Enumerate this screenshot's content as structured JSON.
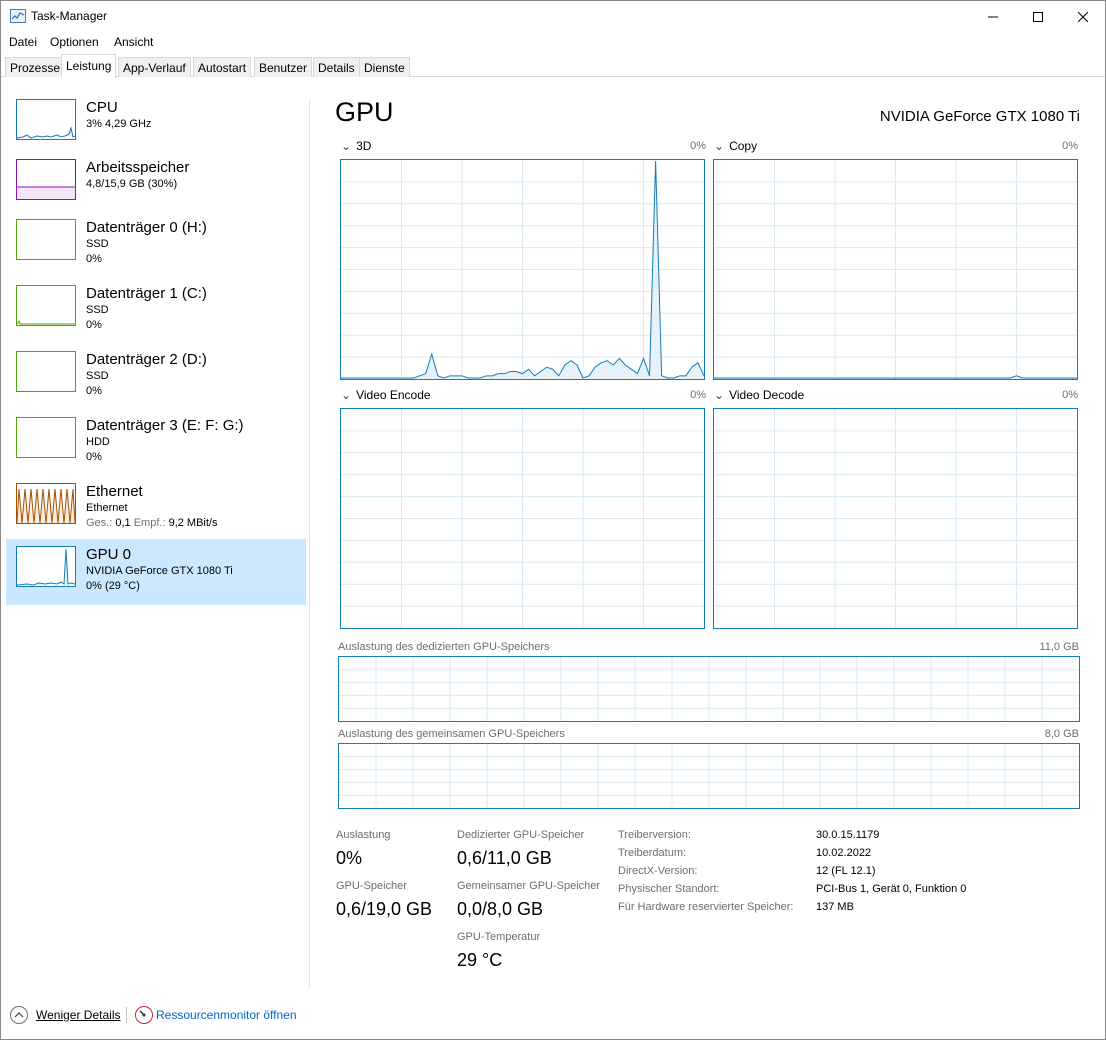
{
  "window": {
    "title": "Task-Manager"
  },
  "menu": [
    "Datei",
    "Optionen",
    "Ansicht"
  ],
  "tabs": [
    "Prozesse",
    "Leistung",
    "App-Verlauf",
    "Autostart",
    "Benutzer",
    "Details",
    "Dienste"
  ],
  "active_tab": "Leistung",
  "sidebar": {
    "items": [
      {
        "name": "CPU",
        "line2": "3% 4,29 GHz",
        "line3": "",
        "color": "#117dbb",
        "icon": "cpu-graph"
      },
      {
        "name": "Arbeitsspeicher",
        "line2": "4,8/15,9 GB (30%)",
        "line3": "",
        "color": "#8b12ae",
        "icon": "memory-graph"
      },
      {
        "name": "Datenträger 0 (H:)",
        "line2": "SSD",
        "line3": "0%",
        "color": "#4da60c",
        "icon": "disk-graph"
      },
      {
        "name": "Datenträger 1 (C:)",
        "line2": "SSD",
        "line3": "0%",
        "color": "#4da60c",
        "icon": "disk-graph"
      },
      {
        "name": "Datenträger 2 (D:)",
        "line2": "SSD",
        "line3": "0%",
        "color": "#4da60c",
        "icon": "disk-graph"
      },
      {
        "name": "Datenträger 3 (E: F: G:)",
        "line2": "HDD",
        "line3": "0%",
        "color": "#4da60c",
        "icon": "disk-graph"
      },
      {
        "name": "Ethernet",
        "line2": "Ethernet",
        "line3_a": "Ges.:",
        "line3_b": "0,1",
        "line3_c": "Empf.:",
        "line3_d": "9,2 MBit/s",
        "color": "#a74f01",
        "icon": "ethernet-graph"
      },
      {
        "name": "GPU 0",
        "line2": "NVIDIA GeForce GTX 1080 Ti",
        "line3": "0% (29 °C)",
        "color": "#117dbb",
        "icon": "gpu-graph"
      }
    ]
  },
  "main": {
    "title": "GPU",
    "device": "NVIDIA GeForce GTX 1080 Ti",
    "engines": [
      {
        "label": "3D",
        "pct": "0%"
      },
      {
        "label": "Copy",
        "pct": "0%"
      },
      {
        "label": "Video Encode",
        "pct": "0%"
      },
      {
        "label": "Video Decode",
        "pct": "0%"
      }
    ],
    "dedicated_label": "Auslastung des dedizierten GPU-Speichers",
    "dedicated_max": "11,0 GB",
    "shared_label": "Auslastung des gemeinsamen GPU-Speichers",
    "shared_max": "8,0 GB",
    "stats": {
      "auslastung_label": "Auslastung",
      "auslastung_value": "0%",
      "gpu_mem_label": "GPU-Speicher",
      "gpu_mem_value": "0,6/19,0 GB",
      "ded_label": "Dedizierter GPU-Speicher",
      "ded_value": "0,6/11,0 GB",
      "shared_label": "Gemeinsamer GPU-Speicher",
      "shared_value": "0,0/8,0 GB",
      "temp_label": "GPU-Temperatur",
      "temp_value": "29 °C"
    },
    "info": [
      {
        "key": "Treiberversion:",
        "value": "30.0.15.1179"
      },
      {
        "key": "Treiberdatum:",
        "value": "10.02.2022"
      },
      {
        "key": "DirectX-Version:",
        "value": "12 (FL 12.1)"
      },
      {
        "key": "Physischer Standort:",
        "value": "PCI-Bus 1, Gerät 0, Funktion 0"
      },
      {
        "key": "Für Hardware reservierter Speicher:",
        "value": "137 MB"
      }
    ]
  },
  "graph_3d_usage": [
    0,
    0,
    0,
    0,
    0,
    0,
    0,
    0,
    0,
    0,
    0,
    0,
    0,
    1,
    2,
    11,
    1,
    0,
    1,
    1,
    1,
    0,
    0,
    0,
    1,
    1,
    2,
    2,
    3,
    3,
    2,
    4,
    1,
    3,
    5,
    4,
    1,
    6,
    8,
    6,
    0,
    1,
    5,
    7,
    8,
    6,
    9,
    6,
    4,
    2,
    9,
    1,
    100,
    1,
    0,
    0,
    1,
    1,
    5,
    7,
    1
  ],
  "graph_copy_usage": [
    0,
    0,
    0,
    0,
    0,
    0,
    0,
    0,
    0,
    0,
    0,
    0,
    0,
    0,
    0,
    0,
    0,
    0,
    0,
    0,
    0,
    0,
    0,
    0,
    0,
    0,
    0,
    0,
    0,
    0,
    0,
    0,
    0,
    0,
    0,
    0,
    0,
    0,
    0,
    0,
    0,
    0,
    0,
    0,
    0,
    0,
    0,
    0,
    0,
    0,
    1,
    0,
    0,
    0,
    0,
    0,
    0,
    0,
    0,
    0,
    0
  ],
  "footer": {
    "less_details": "Weniger Details",
    "resmon": "Ressourcenmonitor öffnen"
  },
  "colors": {
    "gpu": "#117dbb",
    "selected": "#cce8ff",
    "grid": "#d9eaf4"
  }
}
